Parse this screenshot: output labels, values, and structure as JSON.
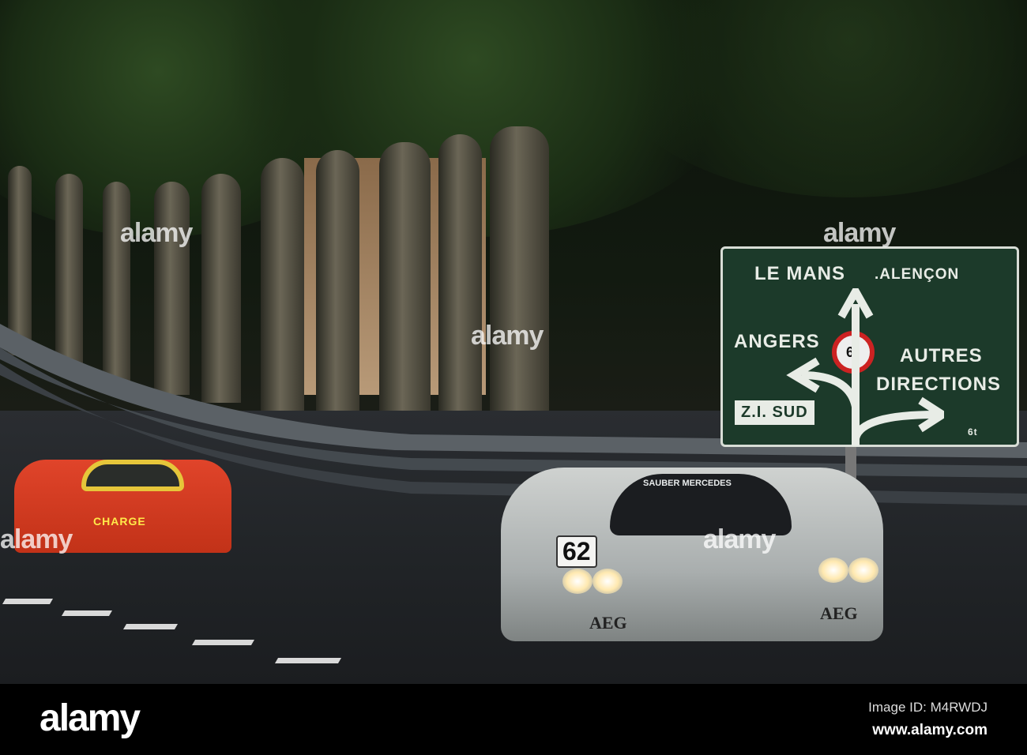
{
  "photo": {
    "watermark_text": "alamy",
    "sign": {
      "top_line": "LE MANS",
      "top_line_2": ".ALENÇON",
      "left": "ANGERS",
      "weight_limit": "6t",
      "right_1": "AUTRES",
      "right_2": "DIRECTIONS",
      "bottom_left": "Z.I. SUD",
      "truck_limit": "6t"
    },
    "lead_car": {
      "number": "62",
      "banner": "SAUBER MERCEDES",
      "sponsor": "AEG"
    },
    "chasing_car": {
      "sponsor": "CHARGE"
    }
  },
  "footer": {
    "logo": "alamy",
    "image_id": "Image ID: M4RWDJ",
    "url": "www.alamy.com"
  }
}
